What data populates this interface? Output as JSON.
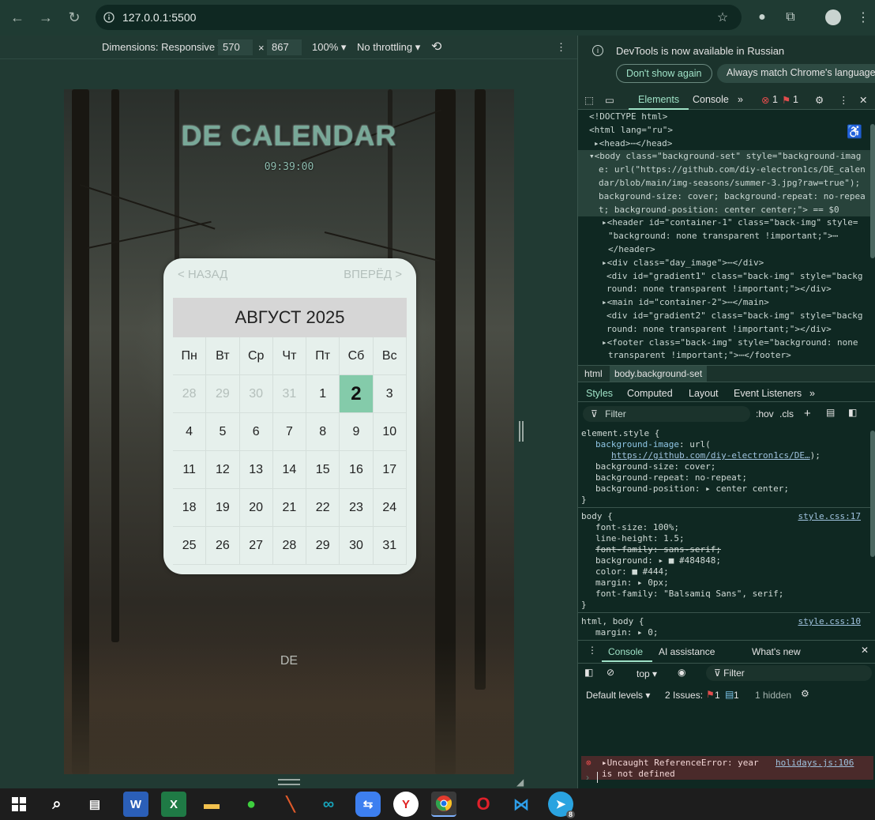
{
  "browser": {
    "url": "127.0.0.1:5500",
    "back_icon": "←",
    "forward_icon": "→",
    "reload_icon": "↻"
  },
  "device_toolbar": {
    "dimensions": "Dimensions: Responsive ▾",
    "width": "570",
    "times": "×",
    "height": "867",
    "zoom": "100% ▾",
    "throttling": "No throttling ▾"
  },
  "app": {
    "title": "DE CALENDAR",
    "clock": "09:39:00",
    "prev": "< НАЗАД",
    "next": "ВПЕРЁД >",
    "month": "АВГУСТ 2025",
    "footer": "DE",
    "weekdays": [
      "Пн",
      "Вт",
      "Ср",
      "Чт",
      "Пт",
      "Сб",
      "Вс"
    ],
    "days": [
      {
        "d": "28",
        "muted": true
      },
      {
        "d": "29",
        "muted": true
      },
      {
        "d": "30",
        "muted": true
      },
      {
        "d": "31",
        "muted": true
      },
      {
        "d": "1"
      },
      {
        "d": "2",
        "today": true
      },
      {
        "d": "3"
      },
      {
        "d": "4"
      },
      {
        "d": "5"
      },
      {
        "d": "6"
      },
      {
        "d": "7"
      },
      {
        "d": "8"
      },
      {
        "d": "9"
      },
      {
        "d": "10"
      },
      {
        "d": "11"
      },
      {
        "d": "12"
      },
      {
        "d": "13"
      },
      {
        "d": "14"
      },
      {
        "d": "15"
      },
      {
        "d": "16"
      },
      {
        "d": "17"
      },
      {
        "d": "18"
      },
      {
        "d": "19"
      },
      {
        "d": "20"
      },
      {
        "d": "21"
      },
      {
        "d": "22"
      },
      {
        "d": "23"
      },
      {
        "d": "24"
      },
      {
        "d": "25"
      },
      {
        "d": "26"
      },
      {
        "d": "27"
      },
      {
        "d": "28"
      },
      {
        "d": "29"
      },
      {
        "d": "30"
      },
      {
        "d": "31"
      }
    ]
  },
  "devtools": {
    "banner_text": "DevTools is now available in Russian",
    "dont_show": "Don't show again",
    "always_match": "Always match Chrome's language",
    "tabs": {
      "elements": "Elements",
      "console": "Console",
      "more": "»",
      "errors": "1",
      "issues": "1"
    },
    "dom_lines": [
      "<!DOCTYPE html>",
      "<html lang=\"ru\">",
      "▸<head>⋯</head>",
      "▾<body class=\"background-set\" style=\"background-imag",
      "e: url(\"https://github.com/diy-electron1cs/DE_calen",
      "dar/blob/main/img-seasons/summer-3.jpg?raw=true\");",
      "background-size: cover; background-repeat: no-repea",
      "t; background-position: center center;\"> == $0",
      "▸<header id=\"container-1\" class=\"back-img\" style=",
      "\"background: none transparent !important;\">⋯",
      "</header>",
      "▸<div class=\"day_image\">⋯</div>",
      "<div id=\"gradient1\" class=\"back-img\" style=\"backg",
      "round: none transparent !important;\"></div>",
      "▸<main id=\"container-2\">⋯</main>",
      "<div id=\"gradient2\" class=\"back-img\" style=\"backg",
      "round: none transparent !important;\"></div>",
      "▸<footer class=\"back-img\" style=\"background: none",
      "transparent !important;\">⋯</footer>"
    ],
    "crumb_html": "html",
    "crumb_body": "body.background-set",
    "styles_tabs": [
      "Styles",
      "Computed",
      "Layout",
      "Event Listeners",
      "»"
    ],
    "filter_placeholder": "Filter",
    "hov": ":hov",
    "cls": ".cls",
    "styles": {
      "element_style": "element.style {",
      "bg_image_prop": "background-image",
      "bg_image_val": ": url(",
      "bg_image_link": "https://github.com/diy-electron1cs/DE…",
      "bg_image_end": ");",
      "l2": "background-size: cover;",
      "l3": "background-repeat: no-repeat;",
      "l4": "background-position: ▸ center center;",
      "close": "}",
      "body_rule": "body {",
      "body_src": "style.css:17",
      "b1": "font-size: 100%;",
      "b2": "line-height: 1.5;",
      "b3": "font-family: sans-serif;",
      "b4": "background: ▸ ■ #484848;",
      "b5": "color: ■ #444;",
      "b6": "margin: ▸ 0px;",
      "b7": "font-family: \"Balsamiq Sans\", serif;",
      "html_rule": "html, body {",
      "html_src": "style.css:10",
      "h1": "margin: ▸ 0;"
    },
    "drawer": {
      "console_tab": "Console",
      "ai_tab": "AI assistance",
      "whats_new": "What's new",
      "top": "top ▾",
      "filter": "Filter",
      "levels": "Default levels ▾",
      "issues": "2 Issues:",
      "issue_err": "1",
      "issue_msg": "1",
      "hidden": "1 hidden",
      "error_l1": "▸Uncaught ReferenceError: year",
      "error_l2": "is not defined",
      "error_src": "holidays.js:106",
      "prompt": "›"
    }
  },
  "taskbar": {
    "word": "W",
    "excel": "X",
    "yandex": "Y",
    "opera": "O",
    "telegram_badge": "8"
  },
  "colors": {
    "accent": "#9fe2c7",
    "today": "#84cbaa",
    "error": "#e24c4c"
  }
}
